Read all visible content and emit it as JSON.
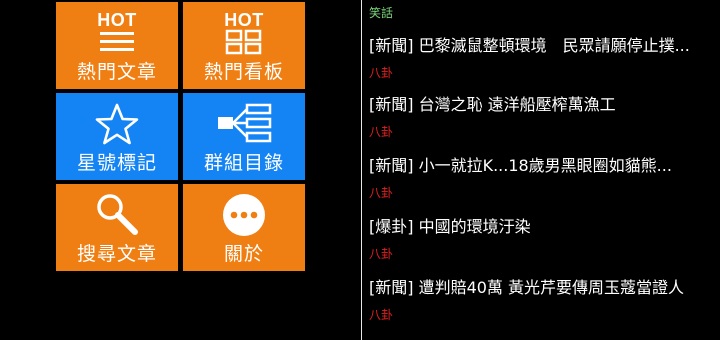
{
  "menu": {
    "tiles": [
      {
        "label": "熱門文章",
        "badge": "HOT",
        "icon": "hot-articles-icon",
        "color": "#f07f13"
      },
      {
        "label": "熱門看板",
        "badge": "HOT",
        "icon": "hot-boards-icon",
        "color": "#f07f13"
      },
      {
        "label": "星號標記",
        "icon": "star-icon",
        "color": "#1484f5"
      },
      {
        "label": "群組目錄",
        "icon": "group-tree-icon",
        "color": "#1484f5"
      },
      {
        "label": "搜尋文章",
        "icon": "search-icon",
        "color": "#f07f13"
      },
      {
        "label": "關於",
        "icon": "more-dots-icon",
        "color": "#f07f13"
      }
    ]
  },
  "feed": {
    "top_board": "笑話",
    "posts": [
      {
        "title": "[新聞] 巴黎滅鼠整頓環境　民眾請願停止撲...",
        "board": "八卦"
      },
      {
        "title": "[新聞] 台灣之恥 遠洋船壓榨萬漁工",
        "board": "八卦"
      },
      {
        "title": "[新聞] 小一就拉K...18歲男黑眼圈如貓熊...",
        "board": "八卦"
      },
      {
        "title": "[爆卦] 中國的環境汙染",
        "board": "八卦"
      },
      {
        "title": "[新聞] 遭判賠40萬 黃光芹要傳周玉蔻當證人",
        "board": "八卦"
      }
    ]
  },
  "colors": {
    "orange": "#f07f13",
    "blue": "#1484f5",
    "board_red": "#e02020",
    "top_board_green": "#7bd37b"
  }
}
